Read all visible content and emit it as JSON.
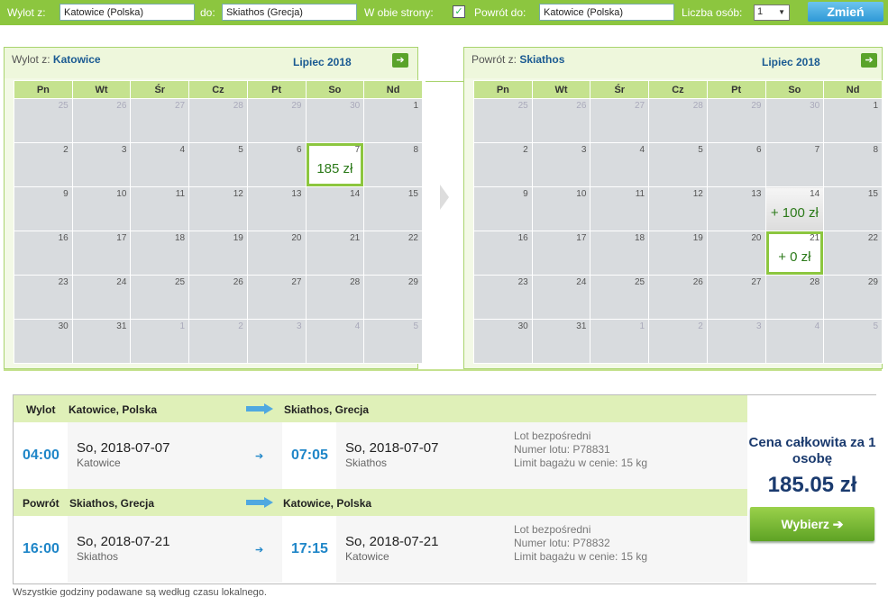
{
  "search": {
    "from_label": "Wylot z:",
    "from_value": "Katowice (Polska)",
    "to_label": "do:",
    "to_value": "Skiathos (Grecja)",
    "roundtrip_label": "W obie strony:",
    "roundtrip_checked": "✓",
    "return_label": "Powrót do:",
    "return_value": "Katowice (Polska)",
    "persons_label": "Liczba osób:",
    "persons_value": "1",
    "change_button": "Zmień"
  },
  "weekdays": [
    "Pn",
    "Wt",
    "Śr",
    "Cz",
    "Pt",
    "So",
    "Nd"
  ],
  "calendar_out": {
    "who_prefix": "Wylot z:",
    "who_city": "Katowice",
    "month": "Lipiec 2018",
    "weeks": [
      [
        {
          "d": "25",
          "out": true
        },
        {
          "d": "26",
          "out": true
        },
        {
          "d": "27",
          "out": true
        },
        {
          "d": "28",
          "out": true
        },
        {
          "d": "29",
          "out": true
        },
        {
          "d": "30",
          "out": true
        },
        {
          "d": "1"
        }
      ],
      [
        {
          "d": "2"
        },
        {
          "d": "3"
        },
        {
          "d": "4"
        },
        {
          "d": "5"
        },
        {
          "d": "6"
        },
        {
          "d": "7",
          "price": "185 zł",
          "sel": true
        },
        {
          "d": "8"
        }
      ],
      [
        {
          "d": "9"
        },
        {
          "d": "10"
        },
        {
          "d": "11"
        },
        {
          "d": "12"
        },
        {
          "d": "13"
        },
        {
          "d": "14"
        },
        {
          "d": "15"
        }
      ],
      [
        {
          "d": "16"
        },
        {
          "d": "17"
        },
        {
          "d": "18"
        },
        {
          "d": "19"
        },
        {
          "d": "20"
        },
        {
          "d": "21"
        },
        {
          "d": "22"
        }
      ],
      [
        {
          "d": "23"
        },
        {
          "d": "24"
        },
        {
          "d": "25"
        },
        {
          "d": "26"
        },
        {
          "d": "27"
        },
        {
          "d": "28"
        },
        {
          "d": "29"
        }
      ],
      [
        {
          "d": "30"
        },
        {
          "d": "31"
        },
        {
          "d": "1",
          "out": true
        },
        {
          "d": "2",
          "out": true
        },
        {
          "d": "3",
          "out": true
        },
        {
          "d": "4",
          "out": true
        },
        {
          "d": "5",
          "out": true
        }
      ]
    ]
  },
  "calendar_ret": {
    "who_prefix": "Powrót z:",
    "who_city": "Skiathos",
    "month": "Lipiec 2018",
    "weeks": [
      [
        {
          "d": "25",
          "out": true
        },
        {
          "d": "26",
          "out": true
        },
        {
          "d": "27",
          "out": true
        },
        {
          "d": "28",
          "out": true
        },
        {
          "d": "29",
          "out": true
        },
        {
          "d": "30",
          "out": true
        },
        {
          "d": "1"
        }
      ],
      [
        {
          "d": "2"
        },
        {
          "d": "3"
        },
        {
          "d": "4"
        },
        {
          "d": "5"
        },
        {
          "d": "6"
        },
        {
          "d": "7"
        },
        {
          "d": "8"
        }
      ],
      [
        {
          "d": "9"
        },
        {
          "d": "10"
        },
        {
          "d": "11"
        },
        {
          "d": "12"
        },
        {
          "d": "13"
        },
        {
          "d": "14",
          "price": "+ 100 zł",
          "opt": true
        },
        {
          "d": "15"
        }
      ],
      [
        {
          "d": "16"
        },
        {
          "d": "17"
        },
        {
          "d": "18"
        },
        {
          "d": "19"
        },
        {
          "d": "20"
        },
        {
          "d": "21",
          "price": "+ 0 zł",
          "sel": true
        },
        {
          "d": "22"
        }
      ],
      [
        {
          "d": "23"
        },
        {
          "d": "24"
        },
        {
          "d": "25"
        },
        {
          "d": "26"
        },
        {
          "d": "27"
        },
        {
          "d": "28"
        },
        {
          "d": "29"
        }
      ],
      [
        {
          "d": "30"
        },
        {
          "d": "31"
        },
        {
          "d": "1",
          "out": true
        },
        {
          "d": "2",
          "out": true
        },
        {
          "d": "3",
          "out": true
        },
        {
          "d": "4",
          "out": true
        },
        {
          "d": "5",
          "out": true
        }
      ]
    ]
  },
  "outbound": {
    "label": "Wylot",
    "from": "Katowice, Polska",
    "to": "Skiathos, Grecja",
    "dep_time": "04:00",
    "dep_date": "So, 2018-07-07",
    "dep_city": "Katowice",
    "arr_time": "07:05",
    "arr_date": "So, 2018-07-07",
    "arr_city": "Skiathos",
    "info1": "Lot bezpośredni",
    "info2": "Numer lotu: P78831",
    "info3": "Limit bagażu w cenie: 15 kg"
  },
  "inbound": {
    "label": "Powrót",
    "from": "Skiathos, Grecja",
    "to": "Katowice, Polska",
    "dep_time": "16:00",
    "dep_date": "So, 2018-07-21",
    "dep_city": "Skiathos",
    "arr_time": "17:15",
    "arr_date": "So, 2018-07-21",
    "arr_city": "Katowice",
    "info1": "Lot bezpośredni",
    "info2": "Numer lotu: P78832",
    "info3": "Limit bagażu w cenie: 15 kg"
  },
  "price": {
    "label": "Cena całkowita za 1 osobę",
    "amount": "185.05 zł",
    "select_button": "Wybierz ➔"
  },
  "note": "Wszystkie godziny podawane są według czasu lokalnego."
}
